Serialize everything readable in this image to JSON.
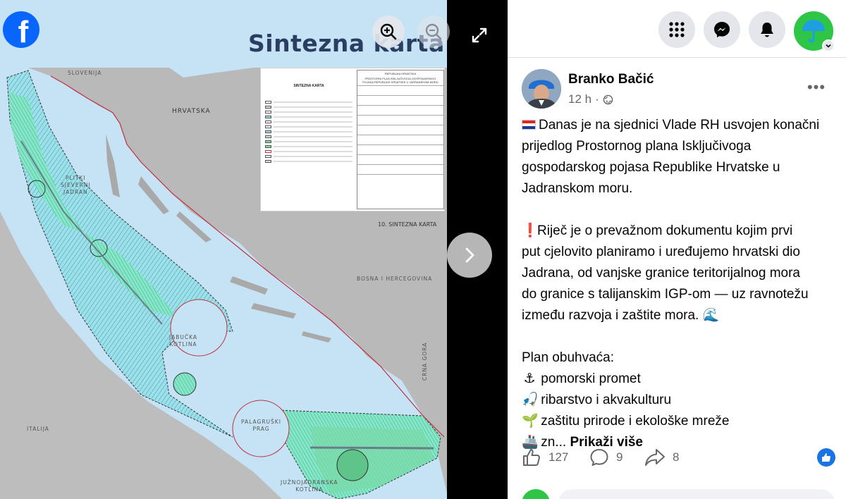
{
  "app": {
    "brand": "facebook",
    "accent_color": "#0866ff"
  },
  "viewer": {
    "image_title": "Sintezna karta",
    "sheet_label": "10. SINTEZNA KARTA",
    "map_labels": {
      "slovenia": "SLOVENIJA",
      "croatia": "HRVATSKA",
      "north_adriatic": "PLITKI\nSJEVERNI\nJADRAN",
      "jabuka": "JABUČKA\nKOTLINA",
      "palagruza": "PALAGRUŠKI\nPRAG",
      "bih": "BOSNA I HERCEGOVINA",
      "italy": "ITALIJA",
      "montenegro": "CRNA GORA",
      "south_adriatic": "JUŽNOJADRANSKA\nKOTLINA"
    },
    "legend_doc": {
      "left_title": "SINTEZNA KARTA",
      "right_header": "REPUBLIKA HRVATSKA",
      "right_title": "PROSTORNI PLAN ISKLJUČIVOGA GOSPODARSKOG POJASA REPUBLIKE HRVATSKE U JADRANSKOM MORU"
    },
    "icons": {
      "zoom_in": "zoom-in-icon",
      "zoom_out": "zoom-out-icon",
      "fullscreen": "fullscreen-icon",
      "next": "chevron-right-icon"
    }
  },
  "topbar": {
    "icons": [
      "menu-grid-icon",
      "messenger-icon",
      "notifications-bell-icon",
      "profile-avatar"
    ]
  },
  "post": {
    "author": "Branko Bačić",
    "time": "12 h",
    "audience_icon": "globe-icon",
    "paragraph1": [
      "Danas je na sjednici Vlade RH usvojen konačni",
      "prijedlog Prostornog plana Isključivoga",
      "gospodarskog pojasa Republike Hrvatske u",
      "Jadranskom moru."
    ],
    "paragraph2": [
      "Riječ je o prevažnom dokumentu kojim prvi",
      "put cjelovito planiramo i uređujemo hrvatski dio",
      "Jadrana, od vanjske granice teritorijalnog mora",
      "do granice s talijanskim IGP-om — uz ravnotežu",
      "između razvoja i zaštite mora."
    ],
    "plan_intro": "Plan obuhvaća:",
    "plan_items": [
      {
        "emoji": "⚓",
        "text": "pomorski promet"
      },
      {
        "emoji": "🎣",
        "text": "ribarstvo i akvakulturu"
      },
      {
        "emoji": "🌱",
        "text": "zaštitu prirode i ekološke mreže"
      },
      {
        "emoji": "🚢",
        "text": "zn..."
      }
    ],
    "see_more": "Prikaži više",
    "emojis": {
      "exclamation": "❗",
      "wave": "🌊"
    }
  },
  "actions": {
    "likes": "127",
    "comments": "9",
    "shares": "8"
  }
}
